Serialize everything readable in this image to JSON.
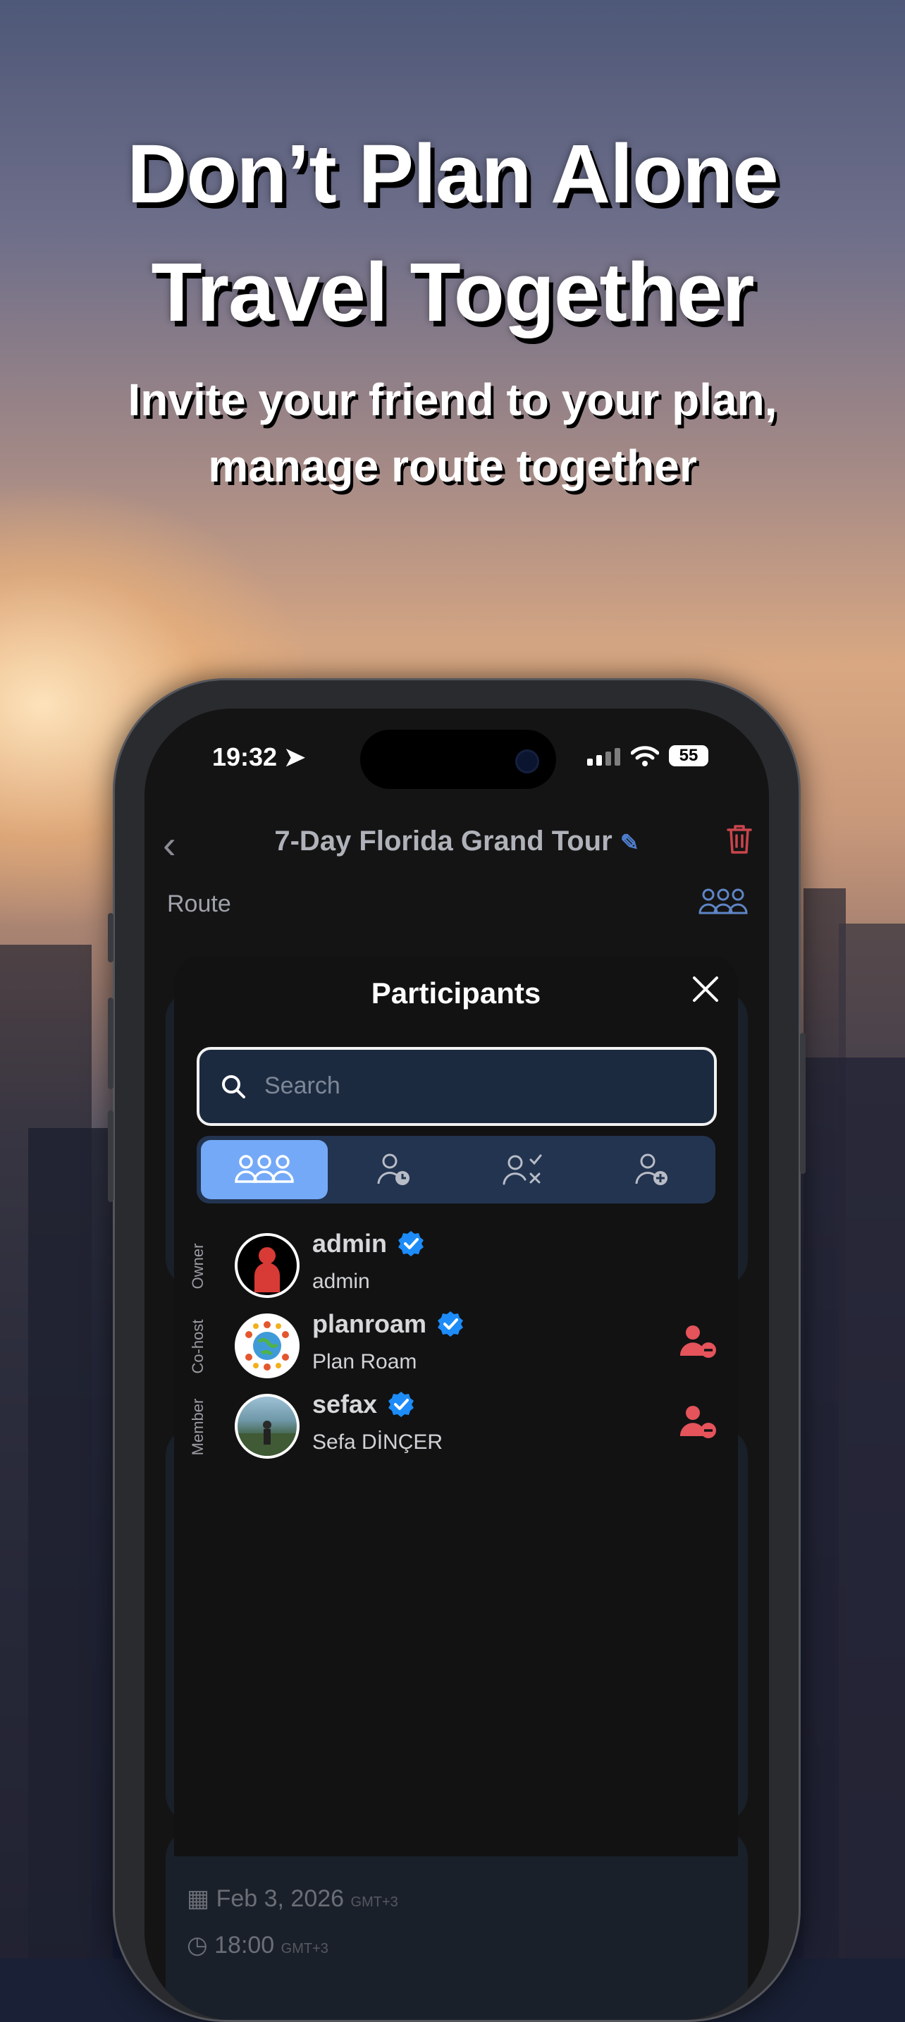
{
  "promo": {
    "headline_line1": "Don’t Plan Alone",
    "headline_line2": "Travel Together",
    "subtitle_line1": "Invite your friend to your plan,",
    "subtitle_line2": "manage route together"
  },
  "status_bar": {
    "time": "19:32",
    "battery": "55"
  },
  "header": {
    "title": "7-Day Florida Grand Tour"
  },
  "route_label": "Route",
  "modal": {
    "title": "Participants",
    "search_placeholder": "Search",
    "tabs": [
      {
        "icon": "group-icon",
        "active": true
      },
      {
        "icon": "person-pending-icon",
        "active": false
      },
      {
        "icon": "person-reject-accept-icon",
        "active": false
      },
      {
        "icon": "person-add-icon",
        "active": false
      }
    ],
    "participants": [
      {
        "role": "Owner",
        "username": "admin",
        "full_name": "admin",
        "verified": true,
        "removable": false
      },
      {
        "role": "Co-host",
        "username": "planroam",
        "full_name": "Plan Roam",
        "verified": true,
        "removable": true
      },
      {
        "role": "Member",
        "username": "sefax",
        "full_name": "Sefa DİNÇER",
        "verified": true,
        "removable": true
      }
    ]
  },
  "background_card": {
    "date": "Feb 3, 2026",
    "date_tz": "GMT+3",
    "time": "18:00",
    "time_tz": "GMT+3"
  },
  "colors": {
    "accent_blue": "#74a9f7",
    "verified_blue": "#1d8cf8",
    "danger_red": "#e5535b"
  }
}
